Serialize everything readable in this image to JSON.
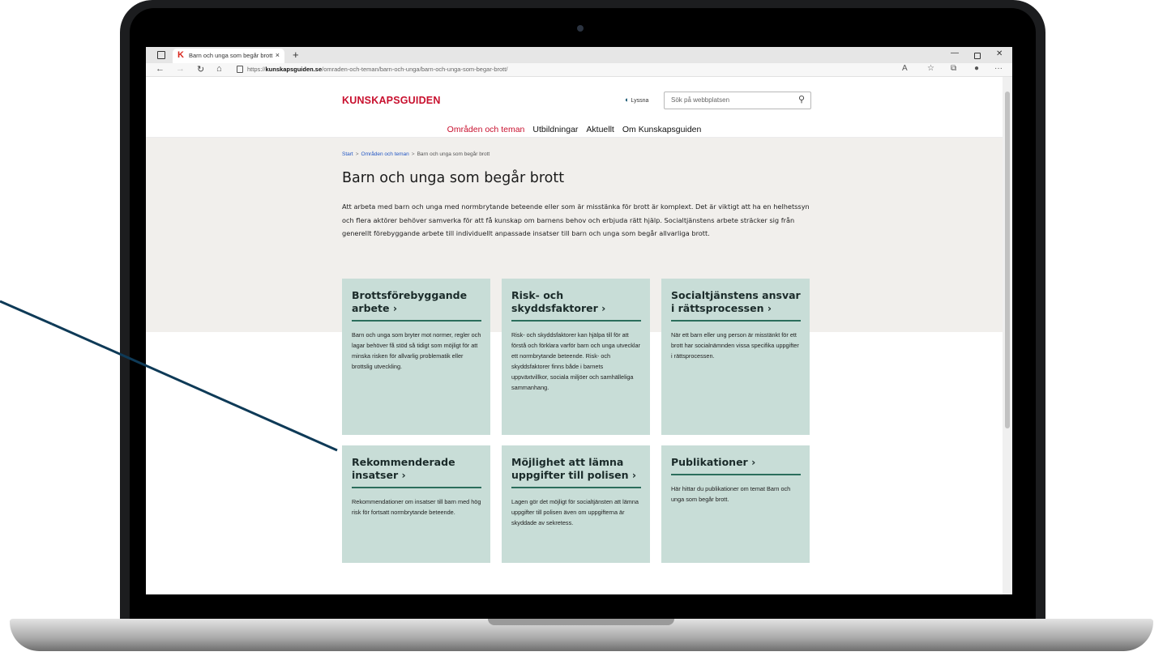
{
  "browser": {
    "tab_title": "Barn och unga som begår brott",
    "tab_favicon": "K",
    "tab_close": "×",
    "new_tab": "+",
    "url_prefix": "https://",
    "url_domain": "kunskapsguiden.se",
    "url_path": "/omraden-och-teman/barn-och-unga/barn-och-unga-som-begar-brott/",
    "icons": [
      "back-icon",
      "forward-icon",
      "reload-icon",
      "home-icon",
      "lock-icon",
      "reader-icon",
      "favorite-icon",
      "collections-icon",
      "profile-icon",
      "more-icon"
    ]
  },
  "header": {
    "logo": "KUNSKAPSGUIDEN",
    "listen": "Lyssna",
    "search_placeholder": "Sök på webbplatsen"
  },
  "nav": {
    "items": [
      {
        "label": "Områden och teman",
        "active": true
      },
      {
        "label": "Utbildningar"
      },
      {
        "label": "Aktuellt"
      },
      {
        "label": "Om Kunskapsguiden"
      }
    ]
  },
  "breadcrumb": {
    "items": [
      "Start",
      "Områden och teman",
      "Barn och unga som begår brott"
    ],
    "separator": ">"
  },
  "main": {
    "title": "Barn och unga som begår brott",
    "intro": "Att arbeta med barn och unga med normbrytande beteende eller som är misstänka för brott är komplext. Det är viktigt att ha en helhetssyn och flera aktörer behöver samverka för att få kunskap om barnens behov och erbjuda rätt hjälp. Socialtjänstens arbete sträcker sig från generellt förebyggande arbete till individuellt anpassade insatser till barn och unga som begår allvarliga brott."
  },
  "cards": [
    {
      "title": "Brottsförebyggande arbete",
      "arrow": "›",
      "text": "Barn och unga som bryter mot normer, regler och lagar behöver få stöd så tidigt som möjligt för att minska risken för allvarlig problematik eller brottslig utveckling."
    },
    {
      "title": "Risk- och skyddsfaktorer",
      "arrow": "›",
      "text": "Risk- och skyddsfaktorer kan hjälpa till för att förstå och förklara varför barn och unga utvecklar ett normbrytande beteende. Risk- och skyddsfaktorer finns både i barnets uppväxtvillkor, sociala miljöer och samhälleliga sammanhang."
    },
    {
      "title": "Socialtjänstens ansvar i rättsprocessen",
      "arrow": "›",
      "text": "När ett barn eller ung person är misstänkt för ett brott har socialnämnden vissa specifika uppgifter i rättsprocessen."
    },
    {
      "title": "Rekommenderade insatser",
      "arrow": "›",
      "text": "Rekommendationer om insatser till barn med hög risk för fortsatt normbrytande beteende."
    },
    {
      "title": "Möjlighet att lämna uppgifter till polisen",
      "arrow": "›",
      "text": "Lagen gör det möjligt för socialtjänsten att lämna uppgifter till polisen även om uppgifterna är skyddade av sekretess."
    },
    {
      "title": "Publikationer",
      "arrow": "›",
      "text": "Här hittar du publikationer om temat Barn och unga som begår brott."
    }
  ],
  "colors": {
    "brand_red": "#c8102e",
    "card_bg": "#c8ddd7",
    "card_rule": "#2b6e5c",
    "hero_bg": "#f1efec",
    "link_blue": "#2458c4",
    "pointer_line": "#0e3a57"
  }
}
